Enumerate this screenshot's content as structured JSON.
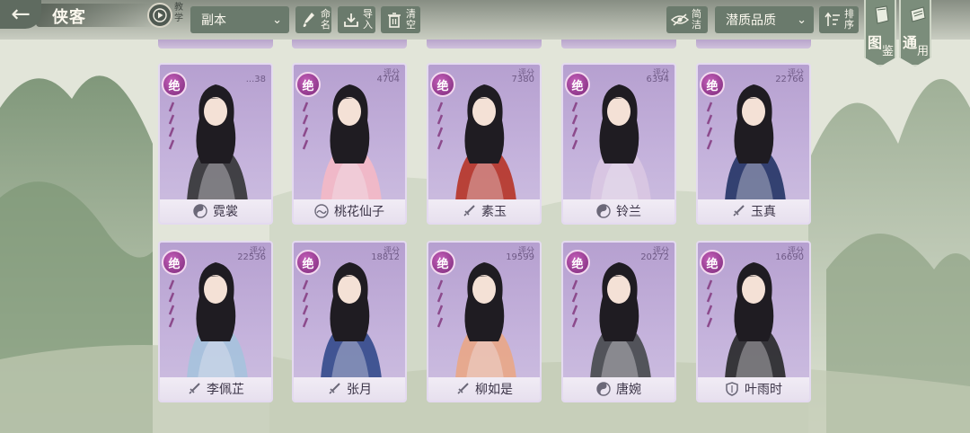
{
  "header": {
    "title": "侠客",
    "tutorial_label": "教学",
    "filter_dropdown": "副本",
    "rename_label": "命名",
    "import_label": "导入",
    "clear_label": "清空",
    "concise_label": "简洁",
    "sort_dropdown": "潜质品质",
    "sort_label": "排序",
    "tab_atlas": {
      "big": "图",
      "small": "鉴"
    },
    "tab_general": {
      "big": "通",
      "small": "用"
    }
  },
  "cards": [
    {
      "name": "霓裳",
      "grade": "绝",
      "score_label": "",
      "score": "...38",
      "sect_icon": "yin-yang-icon",
      "palette": "#3a3a3c"
    },
    {
      "name": "桃花仙子",
      "grade": "绝",
      "score_label": "评分",
      "score": "4704",
      "sect_icon": "wave-emblem-icon",
      "palette": "#f2b8c6"
    },
    {
      "name": "素玉",
      "grade": "绝",
      "score_label": "评分",
      "score": "7380",
      "sect_icon": "sword-icon",
      "palette": "#b73a2e"
    },
    {
      "name": "铃兰",
      "grade": "绝",
      "score_label": "评分",
      "score": "6394",
      "sect_icon": "yin-yang-icon",
      "palette": "#d9c6e2"
    },
    {
      "name": "玉真",
      "grade": "绝",
      "score_label": "评分",
      "score": "22766",
      "sect_icon": "sword-icon",
      "palette": "#2b3a6a"
    },
    {
      "name": "李佩芷",
      "grade": "绝",
      "score_label": "评分",
      "score": "22536",
      "sect_icon": "sword-icon",
      "palette": "#a8c2dc"
    },
    {
      "name": "张月",
      "grade": "绝",
      "score_label": "评分",
      "score": "18812",
      "sect_icon": "sword-icon",
      "palette": "#3a4f8e"
    },
    {
      "name": "柳如是",
      "grade": "绝",
      "score_label": "评分",
      "score": "19599",
      "sect_icon": "sword-icon",
      "palette": "#e8a88a"
    },
    {
      "name": "唐婉",
      "grade": "绝",
      "score_label": "评分",
      "score": "20272",
      "sect_icon": "yin-yang-icon",
      "palette": "#4c4e52"
    },
    {
      "name": "叶雨时",
      "grade": "绝",
      "score_label": "评分",
      "score": "16690",
      "sect_icon": "shield-icon",
      "palette": "#2e2e30"
    }
  ]
}
